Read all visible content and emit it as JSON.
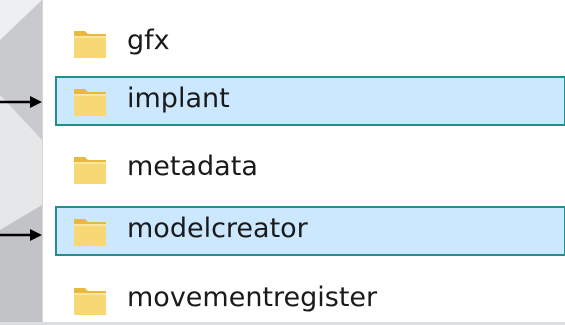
{
  "file_list": {
    "items": [
      {
        "name": "gfx",
        "selected": false,
        "icon": "folder-icon"
      },
      {
        "name": "implant",
        "selected": true,
        "icon": "folder-icon"
      },
      {
        "name": "metadata",
        "selected": false,
        "icon": "folder-icon"
      },
      {
        "name": "modelcreator",
        "selected": true,
        "icon": "folder-icon"
      },
      {
        "name": "movementregister",
        "selected": false,
        "icon": "folder-icon"
      }
    ]
  },
  "annotations": {
    "arrow_color": "#000000",
    "arrow_icon": "arrow-right-icon"
  },
  "colors": {
    "selection_fill": "#cce8ff",
    "selection_border": "#20918a",
    "folder_yellow": "#f8d775"
  }
}
